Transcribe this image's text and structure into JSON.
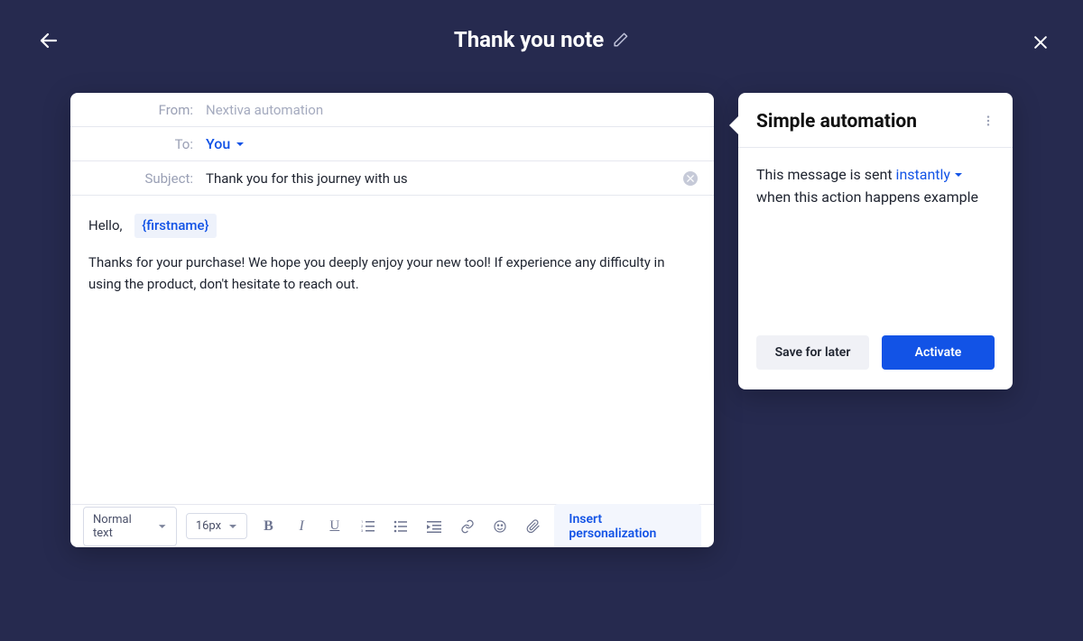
{
  "header": {
    "title": "Thank you note"
  },
  "composer": {
    "from_label": "From:",
    "from_value": "Nextiva automation",
    "to_label": "To:",
    "to_value": "You",
    "subject_label": "Subject:",
    "subject_value": "Thank you for this journey with us",
    "body": {
      "greeting": "Hello,",
      "token": "{firstname}",
      "paragraph": "Thanks for your purchase! We hope you deeply enjoy your new tool! If experience any difficulty in using the product, don't hesitate to reach out."
    }
  },
  "toolbar": {
    "style_select": "Normal text",
    "size_select": "16px",
    "insert_label": "Insert personalization"
  },
  "panel": {
    "title": "Simple automation",
    "text_before": "This message is sent",
    "instant": "instantly",
    "text_after": "when this action happens example",
    "save_label": "Save for later",
    "activate_label": "Activate"
  }
}
